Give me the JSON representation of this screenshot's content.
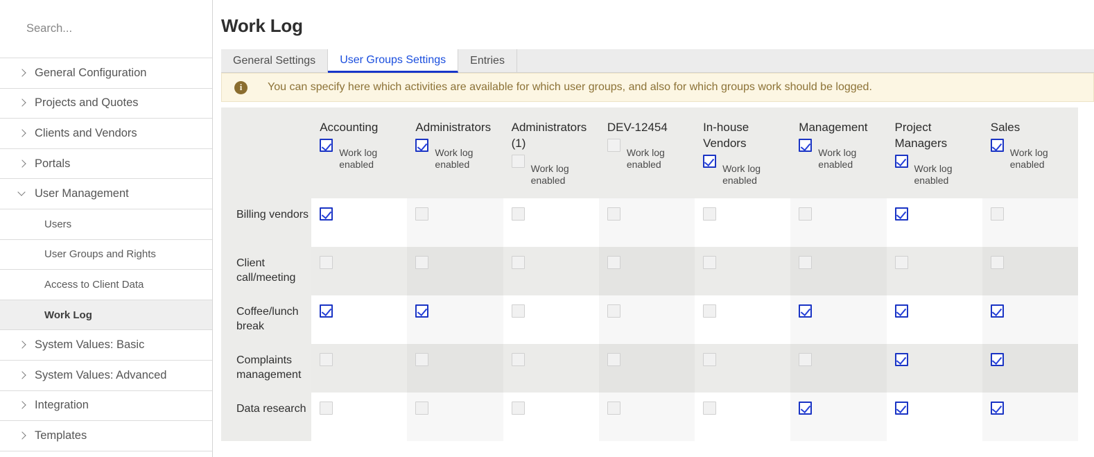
{
  "sidebar": {
    "search": {
      "placeholder": "Search...",
      "value": ""
    },
    "items": [
      {
        "label": "General Configuration",
        "level": 0,
        "chevron": "right",
        "active": false
      },
      {
        "label": "Projects and Quotes",
        "level": 0,
        "chevron": "right",
        "active": false
      },
      {
        "label": "Clients and Vendors",
        "level": 0,
        "chevron": "right",
        "active": false
      },
      {
        "label": "Portals",
        "level": 0,
        "chevron": "right",
        "active": false
      },
      {
        "label": "User Management",
        "level": 0,
        "chevron": "down",
        "active": false
      },
      {
        "label": "Users",
        "level": 1,
        "chevron": "none",
        "active": false
      },
      {
        "label": "User Groups and Rights",
        "level": 1,
        "chevron": "none",
        "active": false
      },
      {
        "label": "Access to Client Data",
        "level": 1,
        "chevron": "none",
        "active": false
      },
      {
        "label": "Work Log",
        "level": 1,
        "chevron": "none",
        "active": true
      },
      {
        "label": "System Values: Basic",
        "level": 0,
        "chevron": "right",
        "active": false
      },
      {
        "label": "System Values: Advanced",
        "level": 0,
        "chevron": "right",
        "active": false
      },
      {
        "label": "Integration",
        "level": 0,
        "chevron": "right",
        "active": false
      },
      {
        "label": "Templates",
        "level": 0,
        "chevron": "right",
        "active": false
      }
    ]
  },
  "header": {
    "title": "Work Log"
  },
  "tabs": [
    {
      "label": "General Settings",
      "active": false
    },
    {
      "label": "User Groups Settings",
      "active": true
    },
    {
      "label": "Entries",
      "active": false
    }
  ],
  "info": {
    "icon": "info-icon",
    "message": "You can specify here which activities are available for which user groups, and also for which groups work should be logged."
  },
  "matrix": {
    "work_log_enabled_label": "Work log enabled",
    "groups": [
      {
        "name": "Accounting",
        "work_log_enabled": true
      },
      {
        "name": "Administrators",
        "work_log_enabled": true
      },
      {
        "name": "Administrators (1)",
        "work_log_enabled": false
      },
      {
        "name": "DEV-12454",
        "work_log_enabled": false
      },
      {
        "name": "In-house Vendors",
        "work_log_enabled": true
      },
      {
        "name": "Management",
        "work_log_enabled": true
      },
      {
        "name": "Project Managers",
        "work_log_enabled": true
      },
      {
        "name": "Sales",
        "work_log_enabled": true
      }
    ],
    "rows": [
      {
        "activity": "Billing vendors",
        "values": [
          true,
          false,
          false,
          false,
          false,
          false,
          true,
          false
        ]
      },
      {
        "activity": "Client call/meeting",
        "values": [
          false,
          false,
          false,
          false,
          false,
          false,
          false,
          false
        ]
      },
      {
        "activity": "Coffee/lunch break",
        "values": [
          true,
          true,
          false,
          false,
          false,
          true,
          true,
          true
        ]
      },
      {
        "activity": "Complaints management",
        "values": [
          false,
          false,
          false,
          false,
          false,
          false,
          true,
          true
        ]
      },
      {
        "activity": "Data research",
        "values": [
          false,
          false,
          false,
          false,
          false,
          true,
          true,
          true
        ]
      }
    ]
  },
  "colors": {
    "accent": "#1a4ede",
    "checkbox_on": "#2540d8",
    "info_bg": "#fcf6e3",
    "info_text": "#8c7236",
    "header_bg": "#ececea"
  }
}
